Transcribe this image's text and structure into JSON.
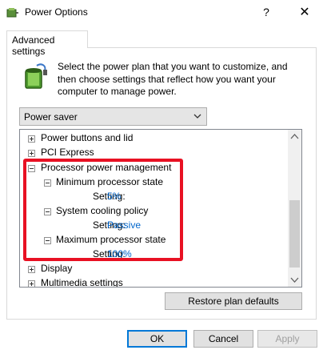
{
  "window": {
    "title": "Power Options",
    "help_glyph": "?",
    "close_glyph": "✕"
  },
  "tabs": [
    {
      "label": "Advanced settings"
    }
  ],
  "description": "Select the power plan that you want to customize, and then choose settings that reflect how you want your computer to manage power.",
  "plan_select": {
    "value": "Power saver"
  },
  "tree": {
    "items": [
      {
        "label": "Power buttons and lid",
        "state": "collapsed"
      },
      {
        "label": "PCI Express",
        "state": "collapsed"
      },
      {
        "label": "Processor power management",
        "state": "expanded"
      },
      {
        "label": "Minimum processor state",
        "state": "expanded",
        "setting_label": "Setting:",
        "setting_value": "5%"
      },
      {
        "label": "System cooling policy",
        "state": "expanded",
        "setting_label": "Setting:",
        "setting_value": "Passive"
      },
      {
        "label": "Maximum processor state",
        "state": "expanded",
        "setting_label": "Setting:",
        "setting_value": "100%"
      },
      {
        "label": "Display",
        "state": "collapsed"
      },
      {
        "label": "Multimedia settings",
        "state": "collapsed"
      }
    ]
  },
  "buttons": {
    "restore": "Restore plan defaults",
    "ok": "OK",
    "cancel": "Cancel",
    "apply": "Apply"
  },
  "colors": {
    "highlight": "#e81123",
    "setting_value": "#0066cc",
    "focus_border": "#0078d7"
  }
}
